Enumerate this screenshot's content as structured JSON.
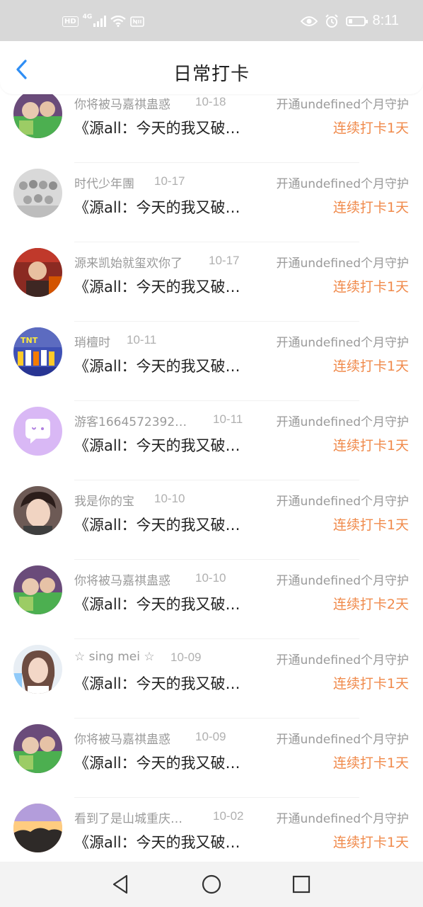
{
  "status_bar": {
    "hd": "HD",
    "network": "4G",
    "time": "8:11",
    "icons": [
      "hd-icon",
      "signal-icon",
      "wifi-icon",
      "nfc-icon",
      "eye-icon",
      "alarm-icon",
      "battery-icon"
    ]
  },
  "header": {
    "title": "日常打卡",
    "back_icon": "chevron-left-icon"
  },
  "colors": {
    "accent_blue": "#2f8ef4",
    "streak_orange": "#f08a4b",
    "meta_gray": "#9a9a9a"
  },
  "checkins": [
    {
      "name": "你将被马嘉祺蛊惑",
      "date": "10-18",
      "guard": "开通undefined个月守护",
      "content": "《源all：今天的我又破防了》",
      "streak": "连续打卡1天"
    },
    {
      "name": "时代少年團",
      "date": "10-17",
      "guard": "开通undefined个月守护",
      "content": "《源all：今天的我又破防了》",
      "streak": "连续打卡1天"
    },
    {
      "name": "源来凯始就玺欢你了",
      "date": "10-17",
      "guard": "开通undefined个月守护",
      "content": "《源all：今天的我又破防了》",
      "streak": "连续打卡1天"
    },
    {
      "name": "琑檀时",
      "date": "10-11",
      "guard": "开通undefined个月守护",
      "content": "《源all：今天的我又破防了》",
      "streak": "连续打卡1天"
    },
    {
      "name": "游客1664572392…",
      "date": "10-11",
      "guard": "开通undefined个月守护",
      "content": "《源all：今天的我又破防了》",
      "streak": "连续打卡1天"
    },
    {
      "name": "我是你的宝",
      "date": "10-10",
      "guard": "开通undefined个月守护",
      "content": "《源all：今天的我又破防了》",
      "streak": "连续打卡1天"
    },
    {
      "name": "你将被马嘉祺蛊惑",
      "date": "10-10",
      "guard": "开通undefined个月守护",
      "content": "《源all：今天的我又破防了》",
      "streak": "连续打卡2天"
    },
    {
      "name": "☆ sing mei ☆",
      "date": "10-09",
      "guard": "开通undefined个月守护",
      "content": "《源all：今天的我又破防了》",
      "streak": "连续打卡1天"
    },
    {
      "name": "你将被马嘉祺蛊惑",
      "date": "10-09",
      "guard": "开通undefined个月守护",
      "content": "《源all：今天的我又破防了》",
      "streak": "连续打卡1天"
    },
    {
      "name": "看到了是山城重庆…",
      "date": "10-02",
      "guard": "开通undefined个月守护",
      "content": "《源all：今天的我又破防了》",
      "streak": "连续打卡1天"
    }
  ],
  "nav_bar": {
    "back_icon": "triangle-back-icon",
    "home_icon": "circle-home-icon",
    "recents_icon": "square-recents-icon"
  }
}
